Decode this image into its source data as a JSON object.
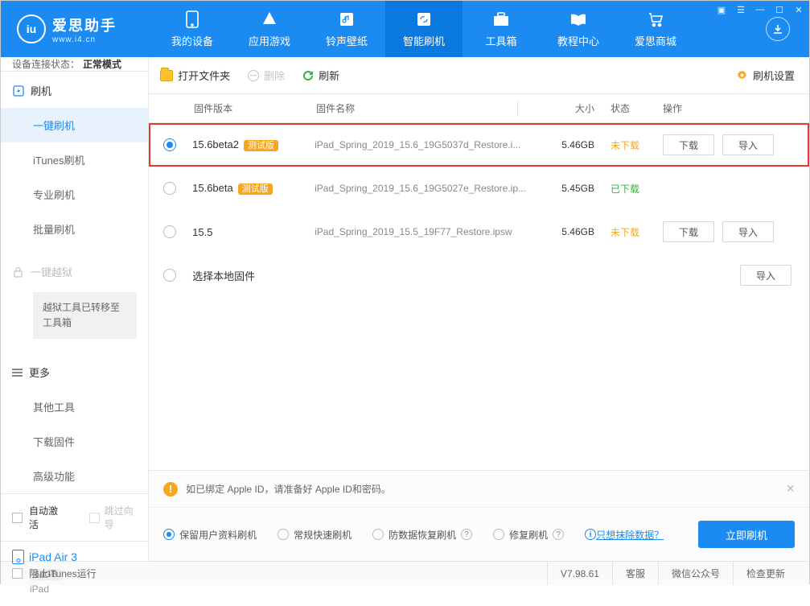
{
  "app": {
    "title": "爱思助手",
    "subtitle": "www.i4.cn"
  },
  "nav": {
    "items": [
      {
        "label": "我的设备"
      },
      {
        "label": "应用游戏"
      },
      {
        "label": "铃声壁纸"
      },
      {
        "label": "智能刷机"
      },
      {
        "label": "工具箱"
      },
      {
        "label": "教程中心"
      },
      {
        "label": "爱思商城"
      }
    ]
  },
  "conn": {
    "prefix": "设备连接状态：",
    "value": "正常模式"
  },
  "sidebar": {
    "section_flash": "刷机",
    "items_flash": [
      "一键刷机",
      "iTunes刷机",
      "专业刷机",
      "批量刷机"
    ],
    "section_jailbreak": "一键越狱",
    "jailbreak_note": "越狱工具已转移至工具箱",
    "section_more": "更多",
    "items_more": [
      "其他工具",
      "下载固件",
      "高级功能"
    ],
    "auto_activate": "自动激活",
    "skip_guide": "跳过向导"
  },
  "device": {
    "name": "iPad Air 3",
    "storage": "64GB",
    "type": "iPad"
  },
  "toolbar": {
    "open": "打开文件夹",
    "delete": "删除",
    "refresh": "刷新",
    "settings": "刷机设置"
  },
  "columns": {
    "version": "固件版本",
    "name": "固件名称",
    "size": "大小",
    "status": "状态",
    "ops": "操作"
  },
  "rows": [
    {
      "selected": true,
      "highlight": true,
      "version": "15.6beta2",
      "badge": "测试版",
      "file": "iPad_Spring_2019_15.6_19G5037d_Restore.i...",
      "size": "5.46GB",
      "status": "未下载",
      "status_class": "orange",
      "ops": [
        "下载",
        "导入"
      ]
    },
    {
      "selected": false,
      "highlight": false,
      "version": "15.6beta",
      "badge": "测试版",
      "file": "iPad_Spring_2019_15.6_19G5027e_Restore.ip...",
      "size": "5.45GB",
      "status": "已下载",
      "status_class": "green",
      "ops": []
    },
    {
      "selected": false,
      "highlight": false,
      "version": "15.5",
      "badge": "",
      "file": "iPad_Spring_2019_15.5_19F77_Restore.ipsw",
      "size": "5.46GB",
      "status": "未下载",
      "status_class": "orange",
      "ops": [
        "下载",
        "导入"
      ]
    },
    {
      "selected": false,
      "highlight": false,
      "version": "",
      "badge": "",
      "file": "",
      "local_label": "选择本地固件",
      "size": "",
      "status": "",
      "status_class": "",
      "ops": [
        "导入"
      ]
    }
  ],
  "notice": "如已绑定 Apple ID，请准备好 Apple ID和密码。",
  "modes": {
    "m1": "保留用户资料刷机",
    "m2": "常规快速刷机",
    "m3": "防数据恢复刷机",
    "m4": "修复刷机",
    "warn": "只想抹除数据？"
  },
  "flash_btn": "立即刷机",
  "statusbar": {
    "block_itunes": "阻止iTunes运行",
    "version": "V7.98.61",
    "support": "客服",
    "wechat": "微信公众号",
    "update": "检查更新"
  }
}
